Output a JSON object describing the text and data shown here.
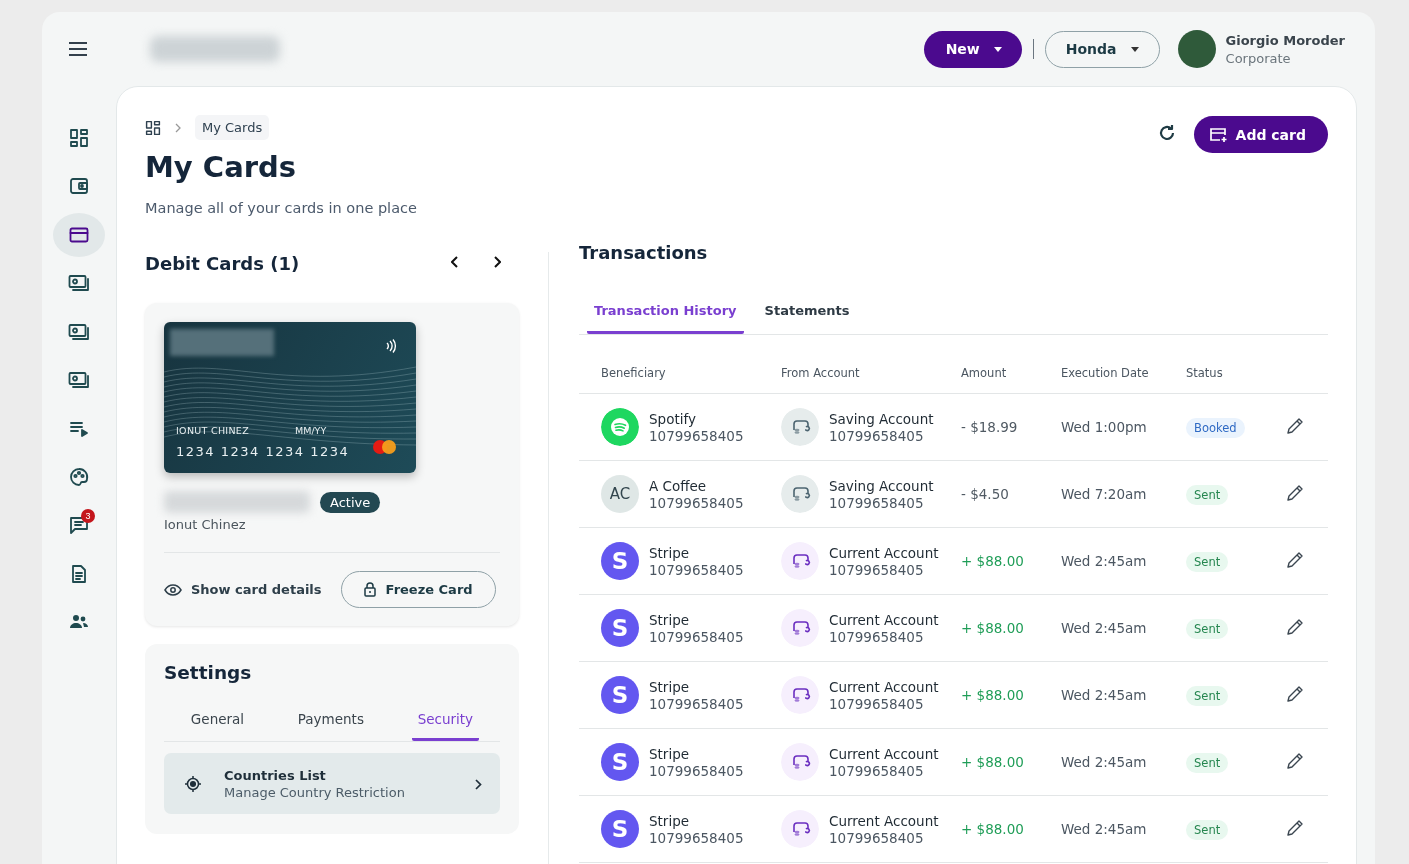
{
  "header": {
    "new_button": "New",
    "company_select": "Honda",
    "user": {
      "name": "Giorgio Moroder",
      "role": "Corporate"
    }
  },
  "sidebar": {
    "items": [
      {
        "kind": "dashboard",
        "selected": false
      },
      {
        "kind": "wallet",
        "selected": false
      },
      {
        "kind": "card",
        "selected": true
      },
      {
        "kind": "cash",
        "selected": false
      },
      {
        "kind": "cash",
        "selected": false
      },
      {
        "kind": "cash",
        "selected": false
      },
      {
        "kind": "list",
        "selected": false
      },
      {
        "kind": "palette",
        "selected": false
      },
      {
        "kind": "chat",
        "selected": false,
        "badge": "3"
      },
      {
        "kind": "document",
        "selected": false
      },
      {
        "kind": "people",
        "selected": false
      }
    ]
  },
  "breadcrumb": {
    "current": "My Cards"
  },
  "page": {
    "title": "My Cards",
    "subtitle": "Manage all of your cards in one place",
    "add_button": "Add card"
  },
  "debit_cards": {
    "title": "Debit Cards (1)",
    "card": {
      "holder": "IONUT CHINEZ",
      "expiry": "MM/YY",
      "number": "1234 1234 1234 1234"
    },
    "status": "Active",
    "owner": "Ionut Chinez",
    "show_details": "Show card details",
    "freeze_button": "Freeze Card"
  },
  "settings": {
    "title": "Settings",
    "tabs": [
      {
        "label": "General",
        "selected": false
      },
      {
        "label": "Payments",
        "selected": false
      },
      {
        "label": "Security",
        "selected": true
      }
    ],
    "item": {
      "title": "Countries List",
      "subtitle": "Manage Country Restriction"
    }
  },
  "transactions": {
    "title": "Transactions",
    "tabs": [
      {
        "label": "Transaction History",
        "selected": true
      },
      {
        "label": "Statements",
        "selected": false
      }
    ],
    "columns": [
      "Beneficiary",
      "From Account",
      "Amount",
      "Execution Date",
      "Status"
    ],
    "rows": [
      {
        "beneficiary": {
          "kind": "spotify",
          "name": "Spotify",
          "number": "10799658405"
        },
        "account": {
          "kind": "saving",
          "name": "Saving Account",
          "number": "10799658405"
        },
        "amount": {
          "kind": "debit",
          "text": "- $18.99"
        },
        "date": "Wed 1:00pm",
        "status": {
          "kind": "booked",
          "label": "Booked"
        }
      },
      {
        "beneficiary": {
          "kind": "initials",
          "logo_text": "AC",
          "name": "A Coffee",
          "number": "10799658405"
        },
        "account": {
          "kind": "saving",
          "name": "Saving Account",
          "number": "10799658405"
        },
        "amount": {
          "kind": "debit",
          "text": "- $4.50"
        },
        "date": "Wed 7:20am",
        "status": {
          "kind": "sent",
          "label": "Sent"
        }
      },
      {
        "beneficiary": {
          "kind": "stripe",
          "logo_text": "S",
          "name": "Stripe",
          "number": "10799658405"
        },
        "account": {
          "kind": "current",
          "name": "Current Account",
          "number": "10799658405"
        },
        "amount": {
          "kind": "credit",
          "text": "+ $88.00"
        },
        "date": "Wed 2:45am",
        "status": {
          "kind": "sent",
          "label": "Sent"
        }
      },
      {
        "beneficiary": {
          "kind": "stripe",
          "logo_text": "S",
          "name": "Stripe",
          "number": "10799658405"
        },
        "account": {
          "kind": "current",
          "name": "Current Account",
          "number": "10799658405"
        },
        "amount": {
          "kind": "credit",
          "text": "+ $88.00"
        },
        "date": "Wed 2:45am",
        "status": {
          "kind": "sent",
          "label": "Sent"
        }
      },
      {
        "beneficiary": {
          "kind": "stripe",
          "logo_text": "S",
          "name": "Stripe",
          "number": "10799658405"
        },
        "account": {
          "kind": "current",
          "name": "Current Account",
          "number": "10799658405"
        },
        "amount": {
          "kind": "credit",
          "text": "+ $88.00"
        },
        "date": "Wed 2:45am",
        "status": {
          "kind": "sent",
          "label": "Sent"
        }
      },
      {
        "beneficiary": {
          "kind": "stripe",
          "logo_text": "S",
          "name": "Stripe",
          "number": "10799658405"
        },
        "account": {
          "kind": "current",
          "name": "Current Account",
          "number": "10799658405"
        },
        "amount": {
          "kind": "credit",
          "text": "+ $88.00"
        },
        "date": "Wed 2:45am",
        "status": {
          "kind": "sent",
          "label": "Sent"
        }
      },
      {
        "beneficiary": {
          "kind": "stripe",
          "logo_text": "S",
          "name": "Stripe",
          "number": "10799658405"
        },
        "account": {
          "kind": "current",
          "name": "Current Account",
          "number": "10799658405"
        },
        "amount": {
          "kind": "credit",
          "text": "+ $88.00"
        },
        "date": "Wed 2:45am",
        "status": {
          "kind": "sent",
          "label": "Sent"
        }
      }
    ]
  }
}
